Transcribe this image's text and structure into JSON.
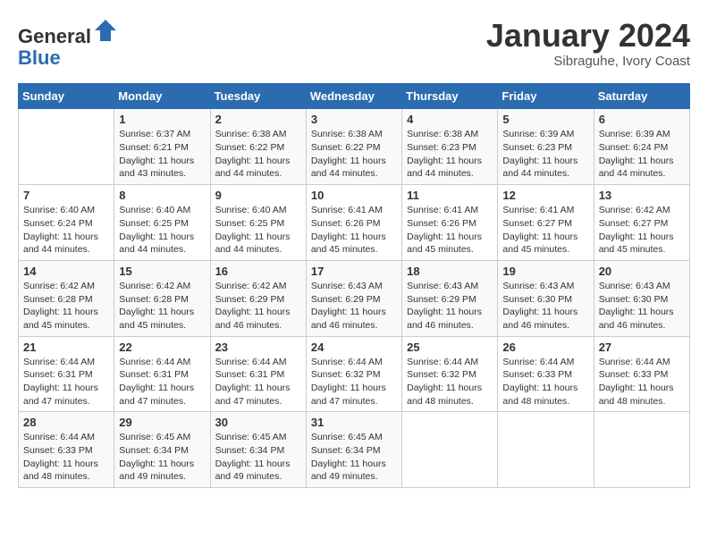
{
  "header": {
    "logo_line1": "General",
    "logo_line2": "Blue",
    "month": "January 2024",
    "location": "Sibraguhe, Ivory Coast"
  },
  "weekdays": [
    "Sunday",
    "Monday",
    "Tuesday",
    "Wednesday",
    "Thursday",
    "Friday",
    "Saturday"
  ],
  "weeks": [
    [
      {
        "day": "",
        "info": ""
      },
      {
        "day": "1",
        "info": "Sunrise: 6:37 AM\nSunset: 6:21 PM\nDaylight: 11 hours\nand 43 minutes."
      },
      {
        "day": "2",
        "info": "Sunrise: 6:38 AM\nSunset: 6:22 PM\nDaylight: 11 hours\nand 44 minutes."
      },
      {
        "day": "3",
        "info": "Sunrise: 6:38 AM\nSunset: 6:22 PM\nDaylight: 11 hours\nand 44 minutes."
      },
      {
        "day": "4",
        "info": "Sunrise: 6:38 AM\nSunset: 6:23 PM\nDaylight: 11 hours\nand 44 minutes."
      },
      {
        "day": "5",
        "info": "Sunrise: 6:39 AM\nSunset: 6:23 PM\nDaylight: 11 hours\nand 44 minutes."
      },
      {
        "day": "6",
        "info": "Sunrise: 6:39 AM\nSunset: 6:24 PM\nDaylight: 11 hours\nand 44 minutes."
      }
    ],
    [
      {
        "day": "7",
        "info": "Sunrise: 6:40 AM\nSunset: 6:24 PM\nDaylight: 11 hours\nand 44 minutes."
      },
      {
        "day": "8",
        "info": "Sunrise: 6:40 AM\nSunset: 6:25 PM\nDaylight: 11 hours\nand 44 minutes."
      },
      {
        "day": "9",
        "info": "Sunrise: 6:40 AM\nSunset: 6:25 PM\nDaylight: 11 hours\nand 44 minutes."
      },
      {
        "day": "10",
        "info": "Sunrise: 6:41 AM\nSunset: 6:26 PM\nDaylight: 11 hours\nand 45 minutes."
      },
      {
        "day": "11",
        "info": "Sunrise: 6:41 AM\nSunset: 6:26 PM\nDaylight: 11 hours\nand 45 minutes."
      },
      {
        "day": "12",
        "info": "Sunrise: 6:41 AM\nSunset: 6:27 PM\nDaylight: 11 hours\nand 45 minutes."
      },
      {
        "day": "13",
        "info": "Sunrise: 6:42 AM\nSunset: 6:27 PM\nDaylight: 11 hours\nand 45 minutes."
      }
    ],
    [
      {
        "day": "14",
        "info": "Sunrise: 6:42 AM\nSunset: 6:28 PM\nDaylight: 11 hours\nand 45 minutes."
      },
      {
        "day": "15",
        "info": "Sunrise: 6:42 AM\nSunset: 6:28 PM\nDaylight: 11 hours\nand 45 minutes."
      },
      {
        "day": "16",
        "info": "Sunrise: 6:42 AM\nSunset: 6:29 PM\nDaylight: 11 hours\nand 46 minutes."
      },
      {
        "day": "17",
        "info": "Sunrise: 6:43 AM\nSunset: 6:29 PM\nDaylight: 11 hours\nand 46 minutes."
      },
      {
        "day": "18",
        "info": "Sunrise: 6:43 AM\nSunset: 6:29 PM\nDaylight: 11 hours\nand 46 minutes."
      },
      {
        "day": "19",
        "info": "Sunrise: 6:43 AM\nSunset: 6:30 PM\nDaylight: 11 hours\nand 46 minutes."
      },
      {
        "day": "20",
        "info": "Sunrise: 6:43 AM\nSunset: 6:30 PM\nDaylight: 11 hours\nand 46 minutes."
      }
    ],
    [
      {
        "day": "21",
        "info": "Sunrise: 6:44 AM\nSunset: 6:31 PM\nDaylight: 11 hours\nand 47 minutes."
      },
      {
        "day": "22",
        "info": "Sunrise: 6:44 AM\nSunset: 6:31 PM\nDaylight: 11 hours\nand 47 minutes."
      },
      {
        "day": "23",
        "info": "Sunrise: 6:44 AM\nSunset: 6:31 PM\nDaylight: 11 hours\nand 47 minutes."
      },
      {
        "day": "24",
        "info": "Sunrise: 6:44 AM\nSunset: 6:32 PM\nDaylight: 11 hours\nand 47 minutes."
      },
      {
        "day": "25",
        "info": "Sunrise: 6:44 AM\nSunset: 6:32 PM\nDaylight: 11 hours\nand 48 minutes."
      },
      {
        "day": "26",
        "info": "Sunrise: 6:44 AM\nSunset: 6:33 PM\nDaylight: 11 hours\nand 48 minutes."
      },
      {
        "day": "27",
        "info": "Sunrise: 6:44 AM\nSunset: 6:33 PM\nDaylight: 11 hours\nand 48 minutes."
      }
    ],
    [
      {
        "day": "28",
        "info": "Sunrise: 6:44 AM\nSunset: 6:33 PM\nDaylight: 11 hours\nand 48 minutes."
      },
      {
        "day": "29",
        "info": "Sunrise: 6:45 AM\nSunset: 6:34 PM\nDaylight: 11 hours\nand 49 minutes."
      },
      {
        "day": "30",
        "info": "Sunrise: 6:45 AM\nSunset: 6:34 PM\nDaylight: 11 hours\nand 49 minutes."
      },
      {
        "day": "31",
        "info": "Sunrise: 6:45 AM\nSunset: 6:34 PM\nDaylight: 11 hours\nand 49 minutes."
      },
      {
        "day": "",
        "info": ""
      },
      {
        "day": "",
        "info": ""
      },
      {
        "day": "",
        "info": ""
      }
    ]
  ]
}
